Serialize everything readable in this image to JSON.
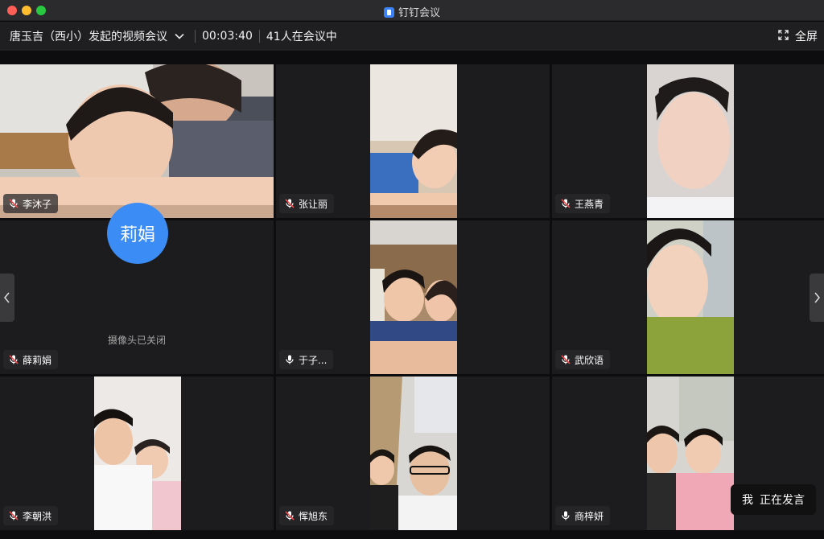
{
  "window": {
    "app_title": "钉钉会议"
  },
  "toolbar": {
    "meeting_title": "唐玉吉（西小）发起的视频会议",
    "timer": "00:03:40",
    "participant_count": "41人在会议中",
    "fullscreen_label": "全屏"
  },
  "participants": [
    {
      "name": "李沐子",
      "mic": "muted"
    },
    {
      "name": "张让丽",
      "mic": "muted"
    },
    {
      "name": "王燕青",
      "mic": "muted"
    },
    {
      "name": "薛莉娟",
      "mic": "muted",
      "avatar_text": "莉娟",
      "camera_off_text": "摄像头已关闭"
    },
    {
      "name": "于子...",
      "mic": "on"
    },
    {
      "name": "武欣语",
      "mic": "muted"
    },
    {
      "name": "李朝洪",
      "mic": "muted"
    },
    {
      "name": "恽旭东",
      "mic": "muted"
    },
    {
      "name": "商梓妍",
      "mic": "on"
    }
  ],
  "speaking": {
    "who": "我",
    "status": "正在发言"
  },
  "more_label": "•••",
  "colors": {
    "avatar_blue": "#3b8cf5",
    "tile_bg": "#1c1c1e",
    "toolbar_bg": "#1f1f21"
  }
}
